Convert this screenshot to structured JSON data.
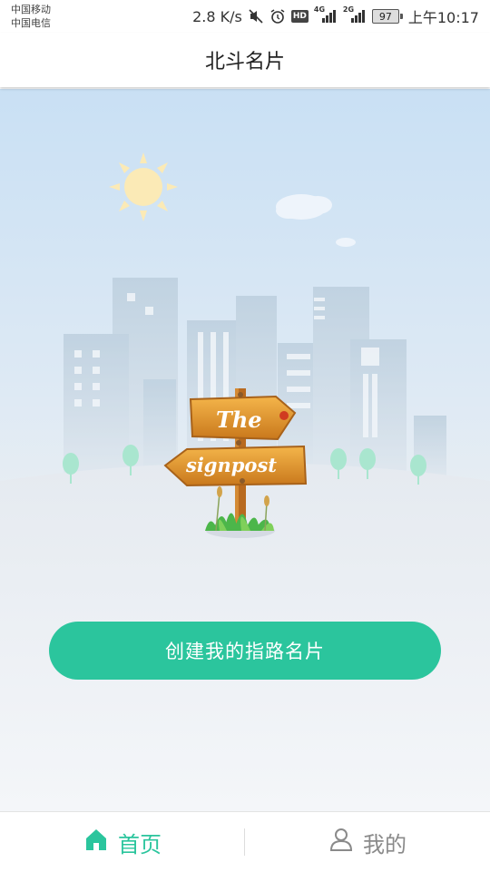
{
  "status_bar": {
    "carrier_1": "中国移动",
    "carrier_2": "中国电信",
    "net_speed": "2.8 K/s",
    "hd_badge": "HD",
    "net_4g": "4G",
    "net_2g": "2G",
    "battery": "97",
    "time": "上午10:17"
  },
  "header": {
    "title": "北斗名片"
  },
  "illustration": {
    "sign_top": "The",
    "sign_bottom": "signpost"
  },
  "main": {
    "cta_label": "创建我的指路名片"
  },
  "bottom_nav": {
    "tabs": [
      {
        "label": "首页",
        "icon": "home-icon",
        "active": true
      },
      {
        "label": "我的",
        "icon": "user-icon",
        "active": false
      }
    ]
  },
  "colors": {
    "accent": "#2bc59d",
    "inactive": "#8a8a8a",
    "sky": "#c9e0f4"
  }
}
